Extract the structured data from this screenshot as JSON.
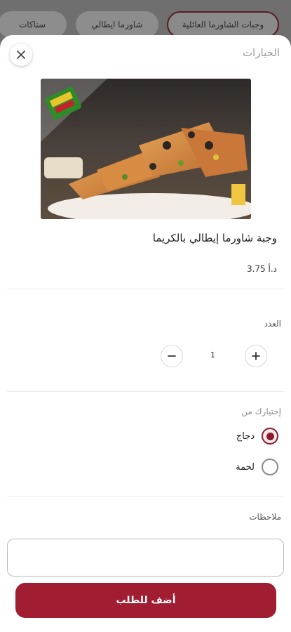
{
  "categories": [
    {
      "label": "وجبات الشاورما العائلية",
      "active": true
    },
    {
      "label": "شاورما ايطالي",
      "active": false
    },
    {
      "label": "سناكات",
      "active": false
    }
  ],
  "sheet": {
    "title": "الخيارات",
    "close_icon": "close-icon"
  },
  "product": {
    "name": "وجبة شاورما إيطالي بالكريما",
    "price": "3.75 د.أ",
    "image_badge": "logo"
  },
  "quantity": {
    "label": "العدد",
    "value": "1",
    "minus_icon": "minus-icon",
    "plus_icon": "plus-icon"
  },
  "options": {
    "label": "إختيارك من",
    "items": [
      {
        "label": "دجاج",
        "selected": true
      },
      {
        "label": "لحمة",
        "selected": false
      }
    ]
  },
  "notes": {
    "label": "ملاحظات",
    "value": "",
    "placeholder": ""
  },
  "actions": {
    "add_to_order": "أضف للطلب"
  },
  "colors": {
    "accent": "#a01d32",
    "overlay": "#6e6e6e"
  }
}
